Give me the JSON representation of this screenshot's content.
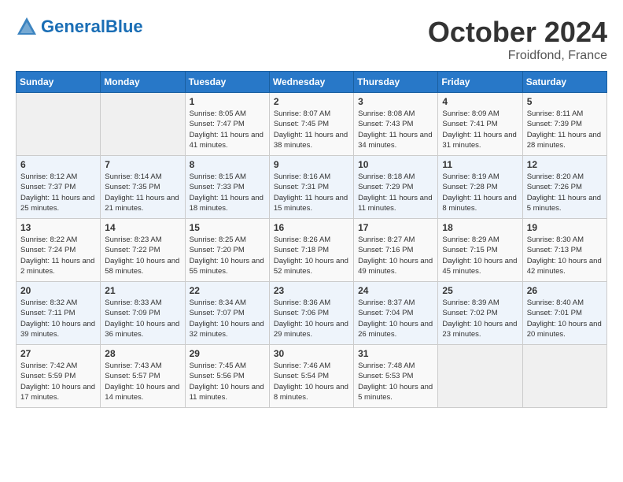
{
  "header": {
    "logo_line1": "General",
    "logo_line2": "Blue",
    "month": "October 2024",
    "location": "Froidfond, France"
  },
  "weekdays": [
    "Sunday",
    "Monday",
    "Tuesday",
    "Wednesday",
    "Thursday",
    "Friday",
    "Saturday"
  ],
  "weeks": [
    [
      {
        "day": "",
        "content": ""
      },
      {
        "day": "",
        "content": ""
      },
      {
        "day": "1",
        "content": "Sunrise: 8:05 AM\nSunset: 7:47 PM\nDaylight: 11 hours and 41 minutes."
      },
      {
        "day": "2",
        "content": "Sunrise: 8:07 AM\nSunset: 7:45 PM\nDaylight: 11 hours and 38 minutes."
      },
      {
        "day": "3",
        "content": "Sunrise: 8:08 AM\nSunset: 7:43 PM\nDaylight: 11 hours and 34 minutes."
      },
      {
        "day": "4",
        "content": "Sunrise: 8:09 AM\nSunset: 7:41 PM\nDaylight: 11 hours and 31 minutes."
      },
      {
        "day": "5",
        "content": "Sunrise: 8:11 AM\nSunset: 7:39 PM\nDaylight: 11 hours and 28 minutes."
      }
    ],
    [
      {
        "day": "6",
        "content": "Sunrise: 8:12 AM\nSunset: 7:37 PM\nDaylight: 11 hours and 25 minutes."
      },
      {
        "day": "7",
        "content": "Sunrise: 8:14 AM\nSunset: 7:35 PM\nDaylight: 11 hours and 21 minutes."
      },
      {
        "day": "8",
        "content": "Sunrise: 8:15 AM\nSunset: 7:33 PM\nDaylight: 11 hours and 18 minutes."
      },
      {
        "day": "9",
        "content": "Sunrise: 8:16 AM\nSunset: 7:31 PM\nDaylight: 11 hours and 15 minutes."
      },
      {
        "day": "10",
        "content": "Sunrise: 8:18 AM\nSunset: 7:29 PM\nDaylight: 11 hours and 11 minutes."
      },
      {
        "day": "11",
        "content": "Sunrise: 8:19 AM\nSunset: 7:28 PM\nDaylight: 11 hours and 8 minutes."
      },
      {
        "day": "12",
        "content": "Sunrise: 8:20 AM\nSunset: 7:26 PM\nDaylight: 11 hours and 5 minutes."
      }
    ],
    [
      {
        "day": "13",
        "content": "Sunrise: 8:22 AM\nSunset: 7:24 PM\nDaylight: 11 hours and 2 minutes."
      },
      {
        "day": "14",
        "content": "Sunrise: 8:23 AM\nSunset: 7:22 PM\nDaylight: 10 hours and 58 minutes."
      },
      {
        "day": "15",
        "content": "Sunrise: 8:25 AM\nSunset: 7:20 PM\nDaylight: 10 hours and 55 minutes."
      },
      {
        "day": "16",
        "content": "Sunrise: 8:26 AM\nSunset: 7:18 PM\nDaylight: 10 hours and 52 minutes."
      },
      {
        "day": "17",
        "content": "Sunrise: 8:27 AM\nSunset: 7:16 PM\nDaylight: 10 hours and 49 minutes."
      },
      {
        "day": "18",
        "content": "Sunrise: 8:29 AM\nSunset: 7:15 PM\nDaylight: 10 hours and 45 minutes."
      },
      {
        "day": "19",
        "content": "Sunrise: 8:30 AM\nSunset: 7:13 PM\nDaylight: 10 hours and 42 minutes."
      }
    ],
    [
      {
        "day": "20",
        "content": "Sunrise: 8:32 AM\nSunset: 7:11 PM\nDaylight: 10 hours and 39 minutes."
      },
      {
        "day": "21",
        "content": "Sunrise: 8:33 AM\nSunset: 7:09 PM\nDaylight: 10 hours and 36 minutes."
      },
      {
        "day": "22",
        "content": "Sunrise: 8:34 AM\nSunset: 7:07 PM\nDaylight: 10 hours and 32 minutes."
      },
      {
        "day": "23",
        "content": "Sunrise: 8:36 AM\nSunset: 7:06 PM\nDaylight: 10 hours and 29 minutes."
      },
      {
        "day": "24",
        "content": "Sunrise: 8:37 AM\nSunset: 7:04 PM\nDaylight: 10 hours and 26 minutes."
      },
      {
        "day": "25",
        "content": "Sunrise: 8:39 AM\nSunset: 7:02 PM\nDaylight: 10 hours and 23 minutes."
      },
      {
        "day": "26",
        "content": "Sunrise: 8:40 AM\nSunset: 7:01 PM\nDaylight: 10 hours and 20 minutes."
      }
    ],
    [
      {
        "day": "27",
        "content": "Sunrise: 7:42 AM\nSunset: 5:59 PM\nDaylight: 10 hours and 17 minutes."
      },
      {
        "day": "28",
        "content": "Sunrise: 7:43 AM\nSunset: 5:57 PM\nDaylight: 10 hours and 14 minutes."
      },
      {
        "day": "29",
        "content": "Sunrise: 7:45 AM\nSunset: 5:56 PM\nDaylight: 10 hours and 11 minutes."
      },
      {
        "day": "30",
        "content": "Sunrise: 7:46 AM\nSunset: 5:54 PM\nDaylight: 10 hours and 8 minutes."
      },
      {
        "day": "31",
        "content": "Sunrise: 7:48 AM\nSunset: 5:53 PM\nDaylight: 10 hours and 5 minutes."
      },
      {
        "day": "",
        "content": ""
      },
      {
        "day": "",
        "content": ""
      }
    ]
  ]
}
